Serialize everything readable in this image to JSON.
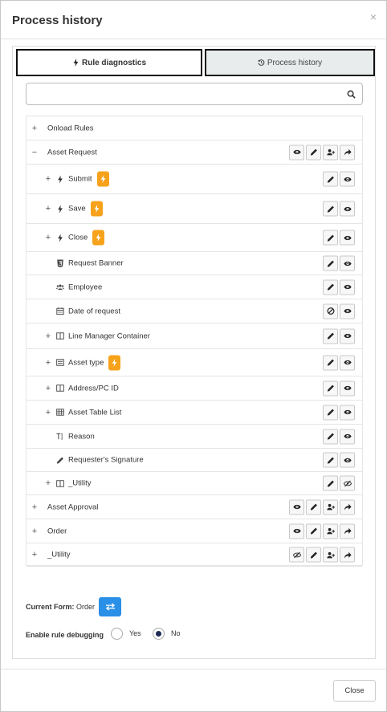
{
  "dialog": {
    "title": "Process history",
    "close_symbol": "×"
  },
  "tabs": [
    {
      "label": "Rule diagnostics",
      "icon": "bolt-icon",
      "active": true
    },
    {
      "label": "Process history",
      "icon": "history-icon",
      "active": false
    }
  ],
  "search": {
    "value": "",
    "placeholder": ""
  },
  "tree": [
    {
      "id": "onload",
      "toggle": "+",
      "label": "Onload Rules",
      "icon": null,
      "bolt": false,
      "actions": []
    },
    {
      "id": "asset-request",
      "toggle": "−",
      "label": "Asset Request",
      "icon": null,
      "bolt": false,
      "actions": [
        "view",
        "edit",
        "assign",
        "forward"
      ]
    },
    {
      "id": "submit",
      "toggle": "+",
      "label": "Submit",
      "icon": "bolt-icon",
      "bolt": true,
      "actions": [
        "edit",
        "view"
      ]
    },
    {
      "id": "save",
      "toggle": "+",
      "label": "Save",
      "icon": "bolt-icon",
      "bolt": true,
      "actions": [
        "edit",
        "view"
      ]
    },
    {
      "id": "close",
      "toggle": "+",
      "label": "Close",
      "icon": "bolt-icon",
      "bolt": true,
      "actions": [
        "edit",
        "view"
      ]
    },
    {
      "id": "request-banner",
      "toggle": "",
      "label": "Request Banner",
      "icon": "html5-icon",
      "bolt": false,
      "actions": [
        "edit",
        "view"
      ]
    },
    {
      "id": "employee",
      "toggle": "",
      "label": "Employee",
      "icon": "users-icon",
      "bolt": false,
      "actions": [
        "edit",
        "view"
      ]
    },
    {
      "id": "date-of-request",
      "toggle": "",
      "label": "Date of request",
      "icon": "calendar-icon",
      "bolt": false,
      "actions": [
        "ban",
        "view"
      ]
    },
    {
      "id": "line-manager",
      "toggle": "+",
      "label": "Line Manager Container",
      "icon": "columns-icon",
      "bolt": false,
      "actions": [
        "edit",
        "view"
      ]
    },
    {
      "id": "asset-type",
      "toggle": "+",
      "label": "Asset type",
      "icon": "dropdown-field-icon",
      "bolt": true,
      "actions": [
        "edit",
        "view"
      ]
    },
    {
      "id": "address",
      "toggle": "+",
      "label": "Address/PC ID",
      "icon": "columns-icon",
      "bolt": false,
      "actions": [
        "edit",
        "view"
      ]
    },
    {
      "id": "asset-table",
      "toggle": "+",
      "label": "Asset Table List",
      "icon": "table-icon",
      "bolt": false,
      "actions": [
        "edit",
        "view"
      ]
    },
    {
      "id": "reason",
      "toggle": "",
      "label": "Reason",
      "icon": "text-field-icon",
      "bolt": false,
      "actions": [
        "edit",
        "view"
      ]
    },
    {
      "id": "signature",
      "toggle": "",
      "label": "Requester's Signature",
      "icon": "pencil-icon",
      "bolt": false,
      "actions": [
        "edit",
        "view"
      ]
    },
    {
      "id": "utility-inner",
      "toggle": "+",
      "label": "_Utility",
      "icon": "columns-icon",
      "bolt": false,
      "actions": [
        "edit",
        "hidden"
      ]
    },
    {
      "id": "asset-approval",
      "toggle": "+",
      "label": "Asset Approval",
      "icon": null,
      "bolt": false,
      "actions": [
        "view",
        "edit",
        "assign",
        "forward"
      ]
    },
    {
      "id": "order",
      "toggle": "+",
      "label": "Order",
      "icon": null,
      "bolt": false,
      "actions": [
        "view",
        "edit",
        "assign",
        "forward"
      ]
    },
    {
      "id": "utility-outer",
      "toggle": "+",
      "label": "_Utility",
      "icon": null,
      "bolt": false,
      "actions": [
        "hidden",
        "edit",
        "assign",
        "forward"
      ]
    }
  ],
  "current_form": {
    "label": "Current Form:",
    "value": "Order",
    "button_icon": "swap-icon"
  },
  "debugging": {
    "label": "Enable rule debugging",
    "options": [
      {
        "label": "Yes",
        "selected": false
      },
      {
        "label": "No",
        "selected": true
      }
    ]
  },
  "footer": {
    "close_label": "Close"
  },
  "colors": {
    "accent": "#2a8fe6",
    "bolt_badge": "#f7a21b",
    "radio_selected": "#1d2a55",
    "active_tab_border": "#111111",
    "inactive_tab_bg": "#e9eced"
  }
}
